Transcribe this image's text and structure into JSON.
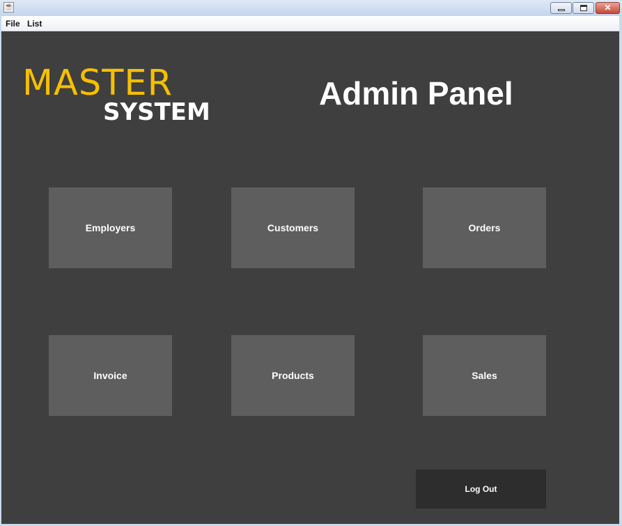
{
  "window": {
    "icon": "java-cup-icon",
    "close_glyph": "✕"
  },
  "menu": {
    "file_label": "File",
    "list_label": "List"
  },
  "logo": {
    "line1": "MASTER",
    "line2": "SYSTEM",
    "accent_color": "#f6c000"
  },
  "header": {
    "title": "Admin Panel"
  },
  "tiles": [
    {
      "label": "Employers"
    },
    {
      "label": "Customers"
    },
    {
      "label": "Orders"
    },
    {
      "label": "Invoice"
    },
    {
      "label": "Products"
    },
    {
      "label": "Sales"
    }
  ],
  "logout": {
    "label": "Log Out"
  },
  "colors": {
    "panel_bg": "#3f3f3f",
    "tile_bg": "#5e5e5e",
    "logout_bg": "#2d2d2d"
  }
}
